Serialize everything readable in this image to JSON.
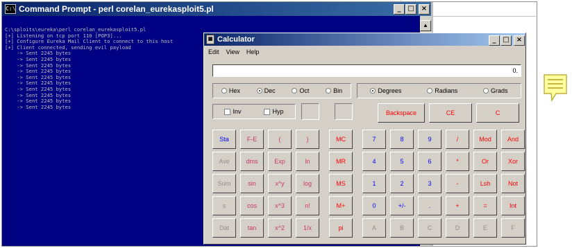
{
  "cmd": {
    "title": "Command Prompt - perl corelan_eurekasploit5.pl",
    "lines": [
      "C:\\sploits\\eureka\\perl corelan_eurekasploit5.pl",
      "[+] Listening on tcp port 110 [POP3]...",
      "[+] Configure Eureka Mail Client to connect to this host",
      "[+] Client connected, sending evil payload",
      "    -> Sent 2245 bytes",
      "    -> Sent 2245 bytes",
      "    -> Sent 2245 bytes",
      "    -> Sent 2245 bytes",
      "    -> Sent 2245 bytes",
      "    -> Sent 2245 bytes",
      "    -> Sent 2245 bytes",
      "    -> Sent 2245 bytes",
      "    -> Sent 2245 bytes",
      "    -> Sent 2245 bytes"
    ]
  },
  "window_buttons": {
    "minimize": "_",
    "maximize": "□",
    "close": "×"
  },
  "calc": {
    "title": "Calculator",
    "menu": [
      "Edit",
      "View",
      "Help"
    ],
    "display_value": "0.",
    "number_systems": [
      "Hex",
      "Dec",
      "Oct",
      "Bin"
    ],
    "number_system_selected": "Dec",
    "angle_units": [
      "Degrees",
      "Radians",
      "Grads"
    ],
    "angle_unit_selected": "Degrees",
    "inv_label": "Inv",
    "hyp_label": "Hyp",
    "backspace": "Backspace",
    "ce": "CE",
    "c": "C",
    "rows": [
      [
        "Sta",
        "F-E",
        "(",
        ")",
        "MC",
        "7",
        "8",
        "9",
        "/",
        "Mod",
        "And"
      ],
      [
        "Ave",
        "dms",
        "Exp",
        "ln",
        "MR",
        "4",
        "5",
        "6",
        "*",
        "Or",
        "Xor"
      ],
      [
        "Sum",
        "sin",
        "x^y",
        "log",
        "MS",
        "1",
        "2",
        "3",
        "-",
        "Lsh",
        "Not"
      ],
      [
        "s",
        "cos",
        "x^3",
        "n!",
        "M+",
        "0",
        "+/-",
        ".",
        "+",
        "=",
        "Int"
      ],
      [
        "Dat",
        "tan",
        "x^2",
        "1/x",
        "pi",
        "A",
        "B",
        "C",
        "D",
        "E",
        "F"
      ]
    ],
    "colors": {
      "blue": "#0000ff",
      "red": "#ff0000",
      "gray": "#8f8f8f",
      "pink": "#cc3366"
    }
  },
  "right": {
    "dot": "."
  }
}
